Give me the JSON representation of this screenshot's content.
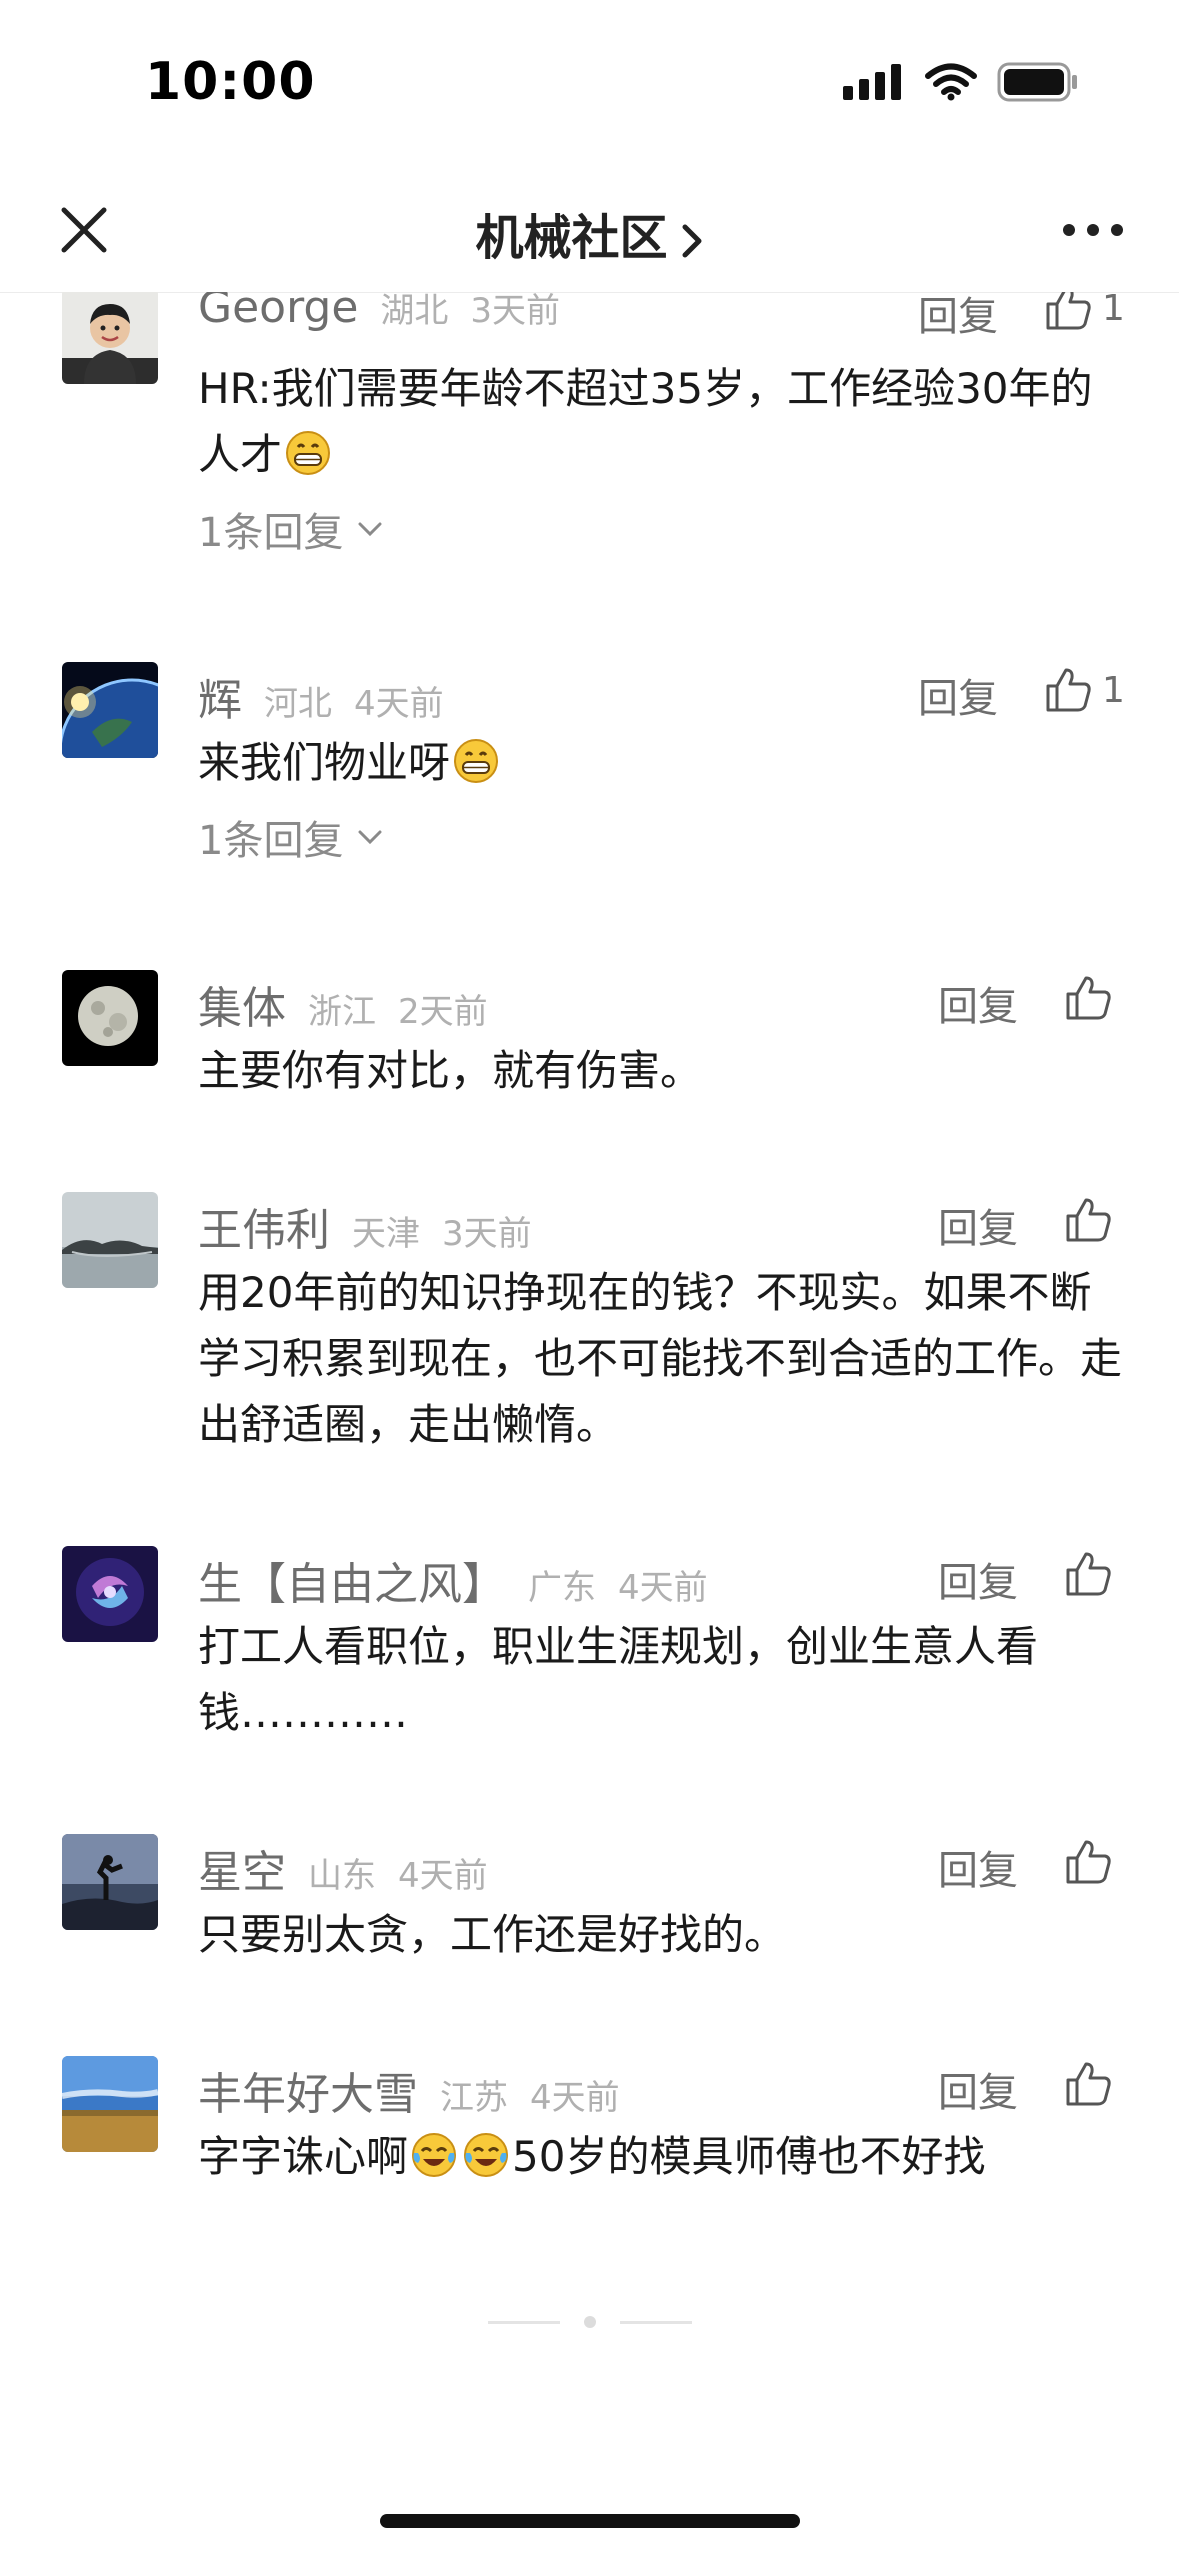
{
  "status_bar": {
    "time": "10:00"
  },
  "nav": {
    "title": "机械社区"
  },
  "comments": [
    {
      "name": "George",
      "location": "湖北",
      "time": "3天前",
      "reply": "回复",
      "likes": "1",
      "text_before": "HR:我们需要年龄不超过35岁，工作经验30年的人才",
      "text_after": "",
      "replies": "1条回复"
    },
    {
      "name": "辉",
      "location": "河北",
      "time": "4天前",
      "reply": "回复",
      "likes": "1",
      "text_before": "来我们物业呀",
      "replies": "1条回复"
    },
    {
      "name": "集体",
      "location": "浙江",
      "time": "2天前",
      "reply": "回复",
      "text": "主要你有对比，就有伤害。"
    },
    {
      "name": "王伟利",
      "location": "天津",
      "time": "3天前",
      "reply": "回复",
      "text": "用20年前的知识挣现在的钱？不现实。如果不断学习积累到现在，也不可能找不到合适的工作。走出舒适圈，走出懒惰。"
    },
    {
      "name": "生【自由之风】",
      "location": "广东",
      "time": "4天前",
      "reply": "回复",
      "text": "打工人看职位，职业生涯规划，创业生意人看钱…………"
    },
    {
      "name": "星空",
      "location": "山东",
      "time": "4天前",
      "reply": "回复",
      "text": "只要别太贪，工作还是好找的。"
    },
    {
      "name": "丰年好大雪",
      "location": "江苏",
      "time": "4天前",
      "reply": "回复",
      "text_before": "字字诛心啊",
      "text_after": "50岁的模具师傅也不好找"
    }
  ],
  "icons": {
    "close": "close-icon",
    "more": "more-icon",
    "chevron": "chevron-right-icon",
    "like": "thumbs-up-icon",
    "grin": "grinning-emoji",
    "cry": "crying-laughing-emoji"
  }
}
